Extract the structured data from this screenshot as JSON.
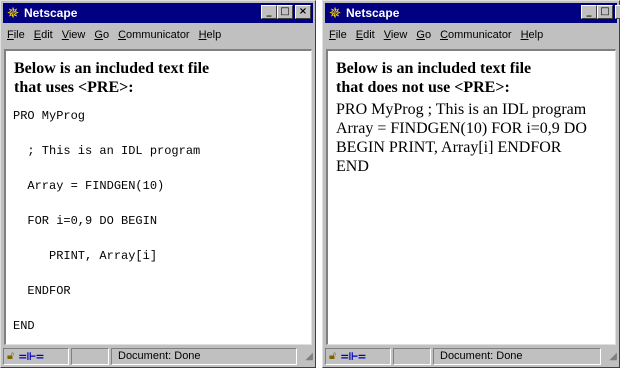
{
  "windows": [
    {
      "title": "Netscape",
      "menu": [
        {
          "key": "F",
          "rest": "ile"
        },
        {
          "key": "E",
          "rest": "dit"
        },
        {
          "key": "V",
          "rest": "iew"
        },
        {
          "key": "G",
          "rest": "o"
        },
        {
          "key": "C",
          "rest": "ommunicator"
        },
        {
          "key": "H",
          "rest": "elp"
        }
      ],
      "heading_line1": "Below is an included text file",
      "heading_line2": "that uses <PRE>:",
      "pre_lines": [
        "PRO MyProg",
        "  ; This is an IDL program",
        "  Array = FINDGEN(10)",
        "  FOR i=0,9 DO BEGIN",
        "     PRINT, Array[i]",
        "  ENDFOR",
        "END"
      ],
      "status": "Document: Done"
    },
    {
      "title": "Netscape",
      "menu": [
        {
          "key": "F",
          "rest": "ile"
        },
        {
          "key": "E",
          "rest": "dit"
        },
        {
          "key": "V",
          "rest": "iew"
        },
        {
          "key": "G",
          "rest": "o"
        },
        {
          "key": "C",
          "rest": "ommunicator"
        },
        {
          "key": "H",
          "rest": "elp"
        }
      ],
      "heading_line1": "Below is an included text file",
      "heading_line2": "that does not use <PRE>:",
      "paragraph_lines": [
        "PRO MyProg ; This is an IDL program",
        "Array = FINDGEN(10) FOR i=0,9 DO",
        "BEGIN PRINT, Array[i] ENDFOR",
        "END"
      ],
      "status": "Document: Done"
    }
  ],
  "icons": {
    "app": "netscape-logo-icon",
    "minimize": "minimize-icon",
    "maximize": "maximize-icon",
    "close": "close-icon",
    "security": "lock-icon",
    "connection": "connection-icon"
  },
  "colors": {
    "titlebar": "#000080",
    "chrome": "#c0c0c0",
    "content": "#ffffff"
  }
}
